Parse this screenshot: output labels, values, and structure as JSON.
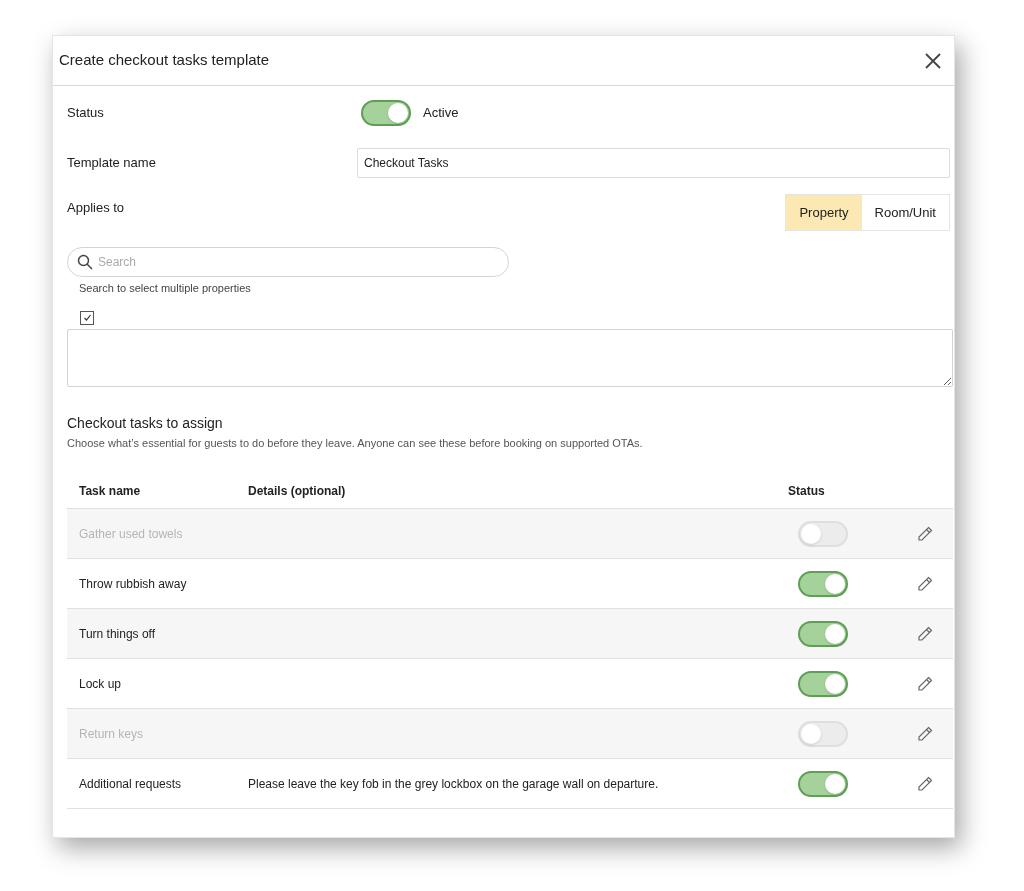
{
  "dialog": {
    "title": "Create checkout tasks template"
  },
  "status": {
    "label": "Status",
    "on": true,
    "text": "Active"
  },
  "template_name": {
    "label": "Template name",
    "value": "Checkout Tasks"
  },
  "applies_to": {
    "label": "Applies to",
    "options": [
      {
        "label": "Property",
        "selected": true
      },
      {
        "label": "Room/Unit",
        "selected": false
      }
    ]
  },
  "search": {
    "placeholder": "Search",
    "hint": "Search to select multiple properties"
  },
  "select_all": {
    "checked": true
  },
  "tasks_section": {
    "title": "Checkout tasks to assign",
    "description": "Choose what’s essential for guests to do before they leave. Anyone can see these before booking on supported OTAs."
  },
  "table": {
    "columns": [
      "Task name",
      "Details (optional)",
      "Status"
    ],
    "rows": [
      {
        "name": "Gather used towels",
        "on": false
      },
      {
        "name": "Throw rubbish away",
        "on": true
      },
      {
        "name": "Turn things off",
        "on": true
      },
      {
        "name": "Lock up",
        "on": true
      },
      {
        "name": "Return keys",
        "on": false
      },
      {
        "name": "Additional requests",
        "details": "Please leave the key fob in the grey lockbox on the garage wall on departure.",
        "on": true
      }
    ]
  }
}
